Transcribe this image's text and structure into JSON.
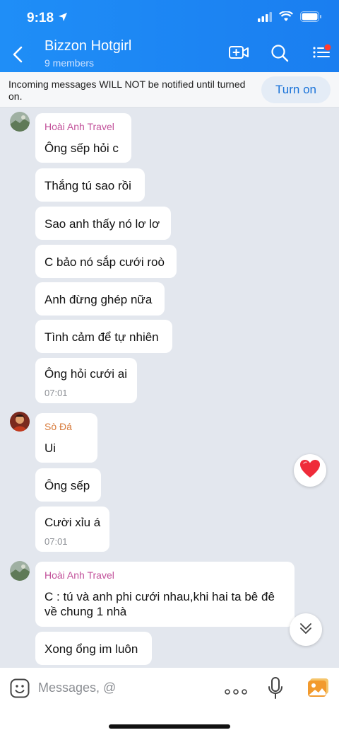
{
  "status_bar": {
    "time": "9:18"
  },
  "header": {
    "title": "Bizzon Hotgirl",
    "subtitle": "9 members"
  },
  "notice": {
    "text": "Incoming messages WILL NOT be notified until turned on.",
    "button_label": "Turn on"
  },
  "messages": [
    {
      "sender": "Hoài Anh Travel",
      "text": "Ông sếp hỏi c"
    },
    {
      "text": "Thắng tú sao rồi"
    },
    {
      "text": "Sao anh thấy nó lơ lơ"
    },
    {
      "text": "C bảo nó sắp cưới roò"
    },
    {
      "text": "Anh đừng ghép nữa"
    },
    {
      "text": "Tình cảm để tự nhiên"
    },
    {
      "text": "Ông hỏi cưới ai",
      "time": "07:01"
    },
    {
      "sender": "Sò Đá",
      "text": "Ui"
    },
    {
      "text": "Ông sếp"
    },
    {
      "text": "Cười xỉu á",
      "time": "07:01"
    },
    {
      "sender": "Hoài Anh Travel",
      "text_line1": "C : tú và anh phi cưới nhau,khi hai ta bê đê",
      "text_line2": "về chung 1 nhà"
    },
    {
      "text": "Xong ổng im luôn"
    }
  ],
  "composer": {
    "placeholder": "Messages, @"
  },
  "colors": {
    "header": "#1f8ef7",
    "sender_hoai_anh": "#c2519a",
    "sender_so_da": "#d77a3a",
    "link": "#1a73d9",
    "background": "#e3e7ee"
  },
  "icons": [
    "back-chevron",
    "video-call",
    "search",
    "menu-list",
    "heart-reaction",
    "chevron-double-down",
    "emoji",
    "more-dots",
    "microphone",
    "photo"
  ]
}
